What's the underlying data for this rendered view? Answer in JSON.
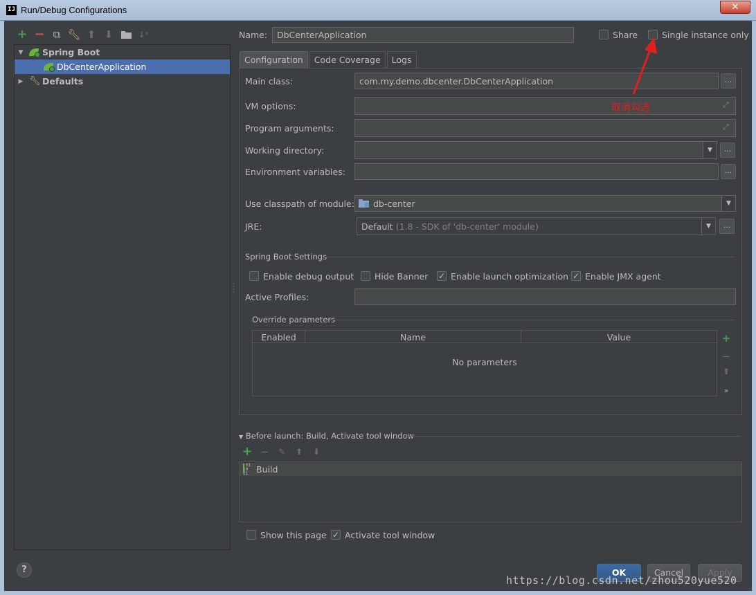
{
  "window": {
    "title": "Run/Debug Configurations",
    "app_icon": "IJ",
    "close_glyph": "✕"
  },
  "left_toolbar": {
    "icons": [
      "add-icon",
      "remove-icon",
      "copy-icon",
      "wrench-icon",
      "move-up-icon",
      "move-down-icon",
      "folder-icon",
      "sort-icon"
    ]
  },
  "tree": {
    "items": [
      {
        "label": "Spring Boot",
        "icon": "spring-boot-icon",
        "expanded": true
      },
      {
        "label": "DbCenterApplication",
        "icon": "spring-app-icon",
        "selected": true
      },
      {
        "label": "Defaults",
        "icon": "wrench-icon",
        "expanded": false
      }
    ]
  },
  "header": {
    "name_label": "Name:",
    "name_value": "DbCenterApplication",
    "share_label": "Share",
    "share_checked": false,
    "single_instance_label": "Single instance only",
    "single_instance_checked": false
  },
  "tabs": [
    {
      "label": "Configuration",
      "active": true
    },
    {
      "label": "Code Coverage",
      "active": false
    },
    {
      "label": "Logs",
      "active": false
    }
  ],
  "config": {
    "main_class_label": "Main class:",
    "main_class_value": "com.my.demo.dbcenter.DbCenterApplication",
    "vm_options_label": "VM options:",
    "vm_options_value": "",
    "program_args_label": "Program arguments:",
    "program_args_value": "",
    "working_dir_label": "Working directory:",
    "working_dir_value": "",
    "env_vars_label": "Environment variables:",
    "env_vars_value": "",
    "classpath_label": "Use classpath of module:",
    "classpath_value": "db-center",
    "jre_label": "JRE:",
    "jre_value": "Default",
    "jre_detail": "(1.8 - SDK of 'db-center' module)",
    "dots": "...",
    "dropdown_glyph": "▼"
  },
  "spring_boot_settings": {
    "title": "Spring Boot Settings",
    "options": [
      {
        "label": "Enable debug output",
        "checked": false
      },
      {
        "label": "Hide Banner",
        "checked": false
      },
      {
        "label": "Enable launch optimization",
        "checked": true
      },
      {
        "label": "Enable JMX agent",
        "checked": true
      }
    ],
    "active_profiles_label": "Active Profiles:",
    "active_profiles_value": ""
  },
  "override_parameters": {
    "title": "Override parameters",
    "columns": [
      "Enabled",
      "Name",
      "Value"
    ],
    "empty_text": "No parameters",
    "side_tools": [
      "add-icon",
      "remove-icon",
      "move-up-icon",
      "more-icon"
    ]
  },
  "before_launch": {
    "title": "Before launch: Build, Activate tool window",
    "toolbar": [
      "add-icon",
      "remove-icon",
      "edit-icon",
      "move-up-icon",
      "move-down-icon"
    ],
    "items": [
      {
        "label": "Build",
        "icon": "build-icon"
      }
    ]
  },
  "footer": {
    "show_page_label": "Show this page",
    "show_page_checked": false,
    "activate_tool_label": "Activate tool window",
    "activate_tool_checked": true,
    "help_glyph": "?",
    "ok_label": "OK",
    "cancel_label": "Cancel",
    "apply_label": "Apply"
  },
  "annotation": {
    "text": "取消勾选",
    "color": "#e02020"
  },
  "watermark": "https://blog.csdn.net/zhou520yue520",
  "colors": {
    "background": "#3c3f41",
    "selection": "#4b6eaf",
    "field": "#45494a",
    "ok_button": "#365880"
  }
}
